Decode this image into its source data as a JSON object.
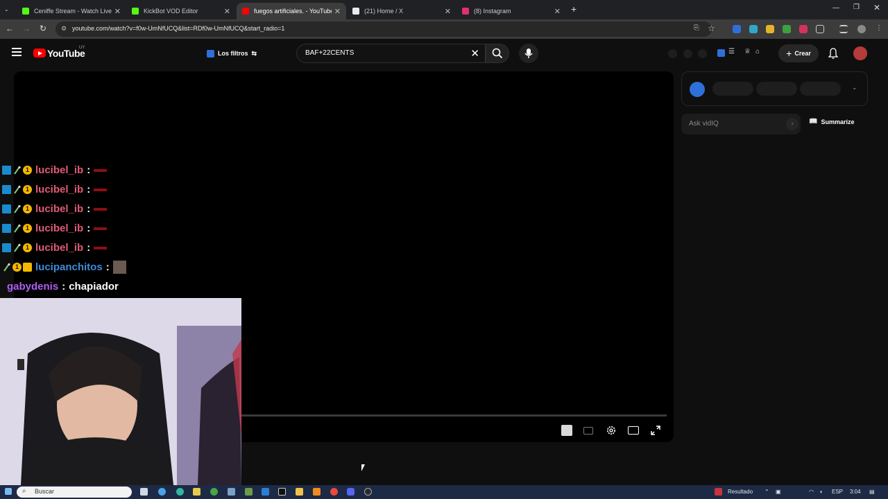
{
  "browser": {
    "tabs": [
      {
        "title": "Ceniffe Stream - Watch Live",
        "color": "#53fc18",
        "active": false
      },
      {
        "title": "KickBot VOD Editor",
        "color": "#53fc18",
        "active": false
      },
      {
        "title": "fuegos artificiales. - YouTube",
        "color": "#ff0000",
        "active": true
      },
      {
        "title": "(21) Home / X",
        "color": "#e7e9ea",
        "active": false
      },
      {
        "title": "(8) Instagram",
        "color": "#e1306c",
        "active": false
      }
    ],
    "url": "youtube.com/watch?v=f0w-UmNfUCQ&list=RDf0w-UmNfUCQ&start_radio=1"
  },
  "youtube": {
    "logo_text": "YouTube",
    "country": "UY",
    "filters_label": "Los filtros",
    "search_value": "BAF+22CENTS",
    "create_label": "Crear"
  },
  "chat": {
    "rows": [
      {
        "user": "lucibel_ib",
        "color": "#e05a76",
        "badges": [
          "prime",
          "flame",
          "one"
        ],
        "emote": true,
        "message": ""
      },
      {
        "user": "lucibel_ib",
        "color": "#e05a76",
        "badges": [
          "prime",
          "flame",
          "one"
        ],
        "emote": true,
        "message": ""
      },
      {
        "user": "lucibel_ib",
        "color": "#e05a76",
        "badges": [
          "prime",
          "flame",
          "one"
        ],
        "emote": true,
        "message": ""
      },
      {
        "user": "lucibel_ib",
        "color": "#e05a76",
        "badges": [
          "prime",
          "flame",
          "one"
        ],
        "emote": true,
        "message": ""
      },
      {
        "user": "lucibel_ib",
        "color": "#e05a76",
        "badges": [
          "prime",
          "flame",
          "one"
        ],
        "emote": true,
        "message": ""
      },
      {
        "user": "lucibel_ib",
        "color": "#e05a76",
        "badges": [
          "prime",
          "flame",
          "one"
        ],
        "emote": true,
        "message": ""
      },
      {
        "user": "lucipanchitos",
        "color": "#3d8bd9",
        "badges": [
          "flame",
          "one",
          "crown"
        ],
        "emote": true,
        "message": ""
      },
      {
        "user": "gabydenis",
        "color": "#b05ef0",
        "badges": [],
        "emote": false,
        "message": "chapiador"
      }
    ]
  },
  "sidebar": {
    "ask_placeholder": "Ask vidIQ",
    "summarize_label": "Summarize"
  },
  "taskbar": {
    "search_placeholder": "Buscar",
    "weather_label": "Resultado",
    "language": "ESP",
    "time": "3:04"
  }
}
